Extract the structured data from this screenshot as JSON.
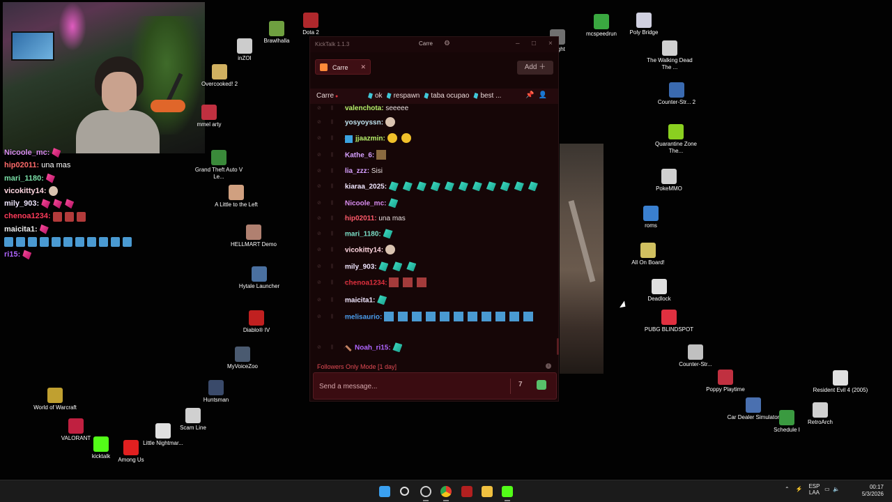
{
  "overlay_chat": [
    {
      "user": "Nicoole_mc",
      "color": "#d98cf0",
      "text": "",
      "emotes": [
        "pink"
      ]
    },
    {
      "user": "hip02011",
      "color": "#ff6a6a",
      "text": "una mas",
      "emotes": []
    },
    {
      "user": "mari_1180",
      "color": "#7be0a8",
      "text": "",
      "emotes": [
        "pink"
      ]
    },
    {
      "user": "vicokitty14",
      "color": "#ffd6e0",
      "text": "",
      "emotes": [
        "cat"
      ]
    },
    {
      "user": "mily_903",
      "color": "#f0e6ff",
      "text": "",
      "emotes": [
        "pink",
        "pink",
        "pink"
      ]
    },
    {
      "user": "chenoa1234",
      "color": "#ff3b5b",
      "text": "",
      "emotes": [
        "red",
        "red",
        "red"
      ]
    },
    {
      "user": "maicita1",
      "color": "#f0f0f0",
      "text": "",
      "emotes": [
        "pink"
      ]
    },
    {
      "user": "",
      "color": "#ffffff",
      "text": "",
      "emotes": [
        "blue",
        "blue",
        "blue",
        "blue",
        "blue",
        "blue",
        "blue",
        "blue",
        "blue",
        "blue",
        "blue"
      ]
    },
    {
      "user": "ri15",
      "color": "#b066ff",
      "text": "",
      "emotes": [
        "pink"
      ]
    }
  ],
  "desktop_icons": [
    {
      "name": "Brawlhalla"
    },
    {
      "name": "Dota 2"
    },
    {
      "name": "inZOI"
    },
    {
      "name": "Overcooked! 2"
    },
    {
      "name": "mmel arty"
    },
    {
      "name": "Grand Theft Auto V Le..."
    },
    {
      "name": "A Little to the Left"
    },
    {
      "name": "HELLMART Demo"
    },
    {
      "name": "Hytale Launcher"
    },
    {
      "name": "Diablo® IV"
    },
    {
      "name": "MyVoiceZoo"
    },
    {
      "name": "Huntsman"
    },
    {
      "name": "World of Warcraft"
    },
    {
      "name": "Scam Line"
    },
    {
      "name": "VALORANT"
    },
    {
      "name": "kicktalk"
    },
    {
      "name": "Among Us"
    },
    {
      "name": "Little Nightmar..."
    },
    {
      "name": "mcspeedrun"
    },
    {
      "name": "Poly Bridge"
    },
    {
      "name": "The Walking Dead The ..."
    },
    {
      "name": "Counter-Str... 2"
    },
    {
      "name": "Quarantine Zone The..."
    },
    {
      "name": "PokeMMO"
    },
    {
      "name": "roms"
    },
    {
      "name": "All On Board!"
    },
    {
      "name": "Deadlock"
    },
    {
      "name": "PUBG BLINDSPOT"
    },
    {
      "name": "Counter-Str..."
    },
    {
      "name": "Poppy Playtime"
    },
    {
      "name": "Resident Evil 4 (2005)"
    },
    {
      "name": "Car Dealer Simulator"
    },
    {
      "name": "Schedule I"
    },
    {
      "name": "RetroArch"
    },
    {
      "name": "by ght"
    }
  ],
  "kicktalk": {
    "title": "KickTalk 1.1.3",
    "title_channel": "Carre",
    "tab_label": "Carre",
    "add_label": "Add",
    "channel_name": "Carre",
    "pinned": [
      "ok",
      "respawn",
      "taba ocupao",
      "best ..."
    ],
    "messages": [
      {
        "user": "valenchota",
        "color": "#b6f06a",
        "text": "seeeee",
        "emotes": []
      },
      {
        "user": "yosyoyssn",
        "color": "#c0e4f0",
        "text": "",
        "emotes": [
          "cat"
        ]
      },
      {
        "user": "jjaazmin",
        "color": "#b6f06a",
        "text": "",
        "emotes": [
          "yellow",
          "yellow"
        ],
        "badge": "cube"
      },
      {
        "user": "Kathe_6",
        "color": "#d6a0ff",
        "text": "",
        "emotes": [
          "brown"
        ]
      },
      {
        "user": "lia_zzz",
        "color": "#d6a0ff",
        "text": "Sisi",
        "emotes": []
      },
      {
        "user": "kiaraa_2025",
        "color": "#f0e6ff",
        "text": "",
        "emotes": [
          "teal",
          "teal",
          "teal",
          "teal",
          "teal",
          "teal",
          "teal",
          "teal",
          "teal",
          "teal",
          "teal"
        ]
      },
      {
        "user": "Nicoole_mc",
        "color": "#d98cf0",
        "text": "",
        "emotes": [
          "teal"
        ]
      },
      {
        "user": "hip02011",
        "color": "#ff5a6a",
        "text": "una mas",
        "emotes": []
      },
      {
        "user": "mari_1180",
        "color": "#7be0c8",
        "text": "",
        "emotes": [
          "teal"
        ]
      },
      {
        "user": "vicokitty14",
        "color": "#ffd6e0",
        "text": "",
        "emotes": [
          "cat"
        ]
      },
      {
        "user": "mily_903",
        "color": "#f0e6ff",
        "text": "",
        "emotes": [
          "teal",
          "teal",
          "teal"
        ]
      },
      {
        "user": "chenoa1234",
        "color": "#e0303e",
        "text": "",
        "emotes": [
          "red",
          "red",
          "red"
        ]
      },
      {
        "user": "maicita1",
        "color": "#f0e6ff",
        "text": "",
        "emotes": [
          "teal"
        ]
      },
      {
        "user": "melisaurio",
        "color": "#4a9ef0",
        "text": "",
        "emotes": [
          "blue",
          "blue",
          "blue",
          "blue",
          "blue",
          "blue",
          "blue",
          "blue",
          "blue",
          "blue",
          "blue"
        ]
      },
      {
        "user": "Noah_ri15",
        "color": "#b066ff",
        "text": "",
        "emotes": [
          "teal"
        ],
        "badge": "sword"
      }
    ],
    "status": "Followers Only Mode [1 day]",
    "input_placeholder": "Send a message..."
  },
  "taskbar": {
    "lang_top": "ESP",
    "lang_bottom": "LAA",
    "time": "00:17",
    "date": "5/3/2026"
  }
}
